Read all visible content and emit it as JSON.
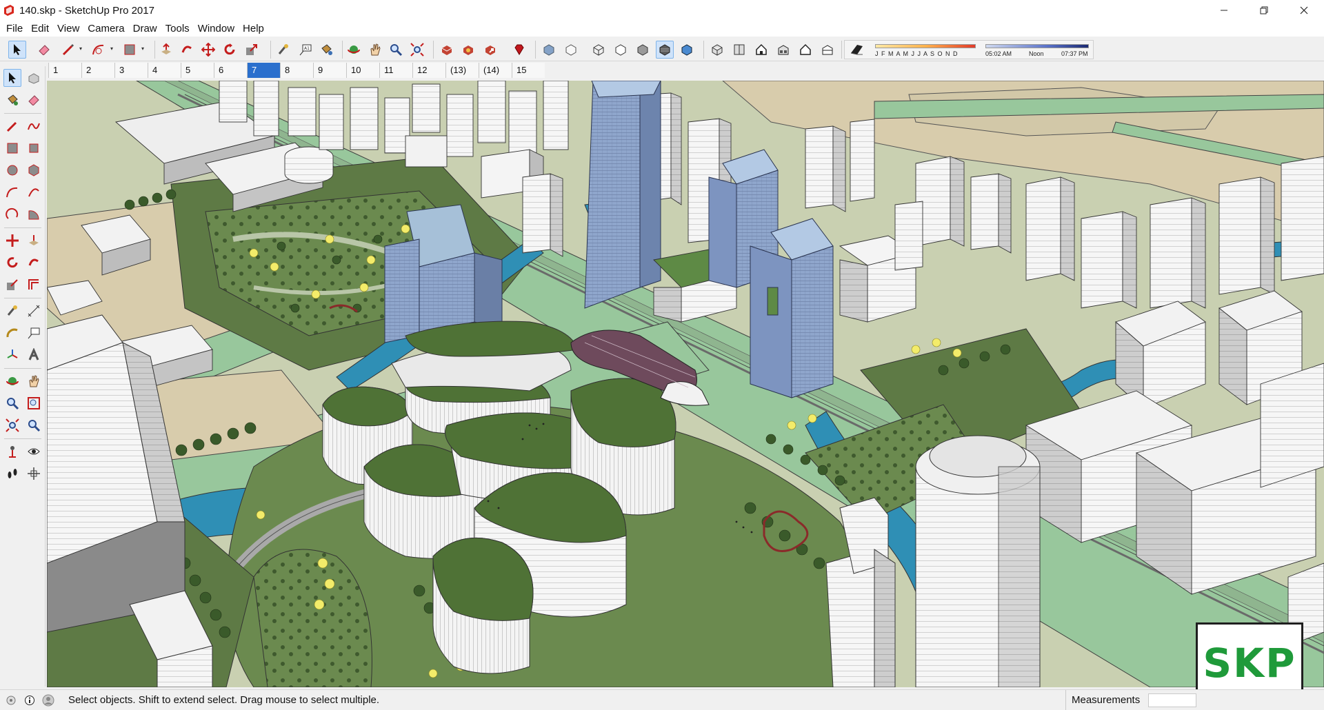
{
  "window": {
    "title": "140.skp - SketchUp Pro 2017",
    "minimize_icon": "minimize-icon",
    "maximize_icon": "restore-icon",
    "close_icon": "close-icon"
  },
  "menu": {
    "items": [
      "File",
      "Edit",
      "View",
      "Camera",
      "Draw",
      "Tools",
      "Window",
      "Help"
    ]
  },
  "shadows": {
    "months": "J F M A M J J A S O N D",
    "time_start": "05:02 AM",
    "time_mid": "Noon",
    "time_end": "07:37 PM"
  },
  "scenes": {
    "tabs": [
      "1",
      "2",
      "3",
      "4",
      "5",
      "6",
      "7",
      "8",
      "9",
      "10",
      "11",
      "12",
      "(13)",
      "(14)",
      "15"
    ],
    "active_index": 6
  },
  "status": {
    "message": "Select objects. Shift to extend select. Drag mouse to select multiple.",
    "measurements_label": "Measurements",
    "measurements_value": ""
  },
  "badge": {
    "text": "SKP"
  },
  "colors": {
    "ground": "#c2cca8",
    "road": "#98c79c",
    "water": "#2f8fb5",
    "park": "#5e7a45",
    "building_white": "#f2f2f2",
    "glass": "#8fa6cc",
    "sand": "#d6c9a6",
    "accent": "#2a6fcd"
  }
}
